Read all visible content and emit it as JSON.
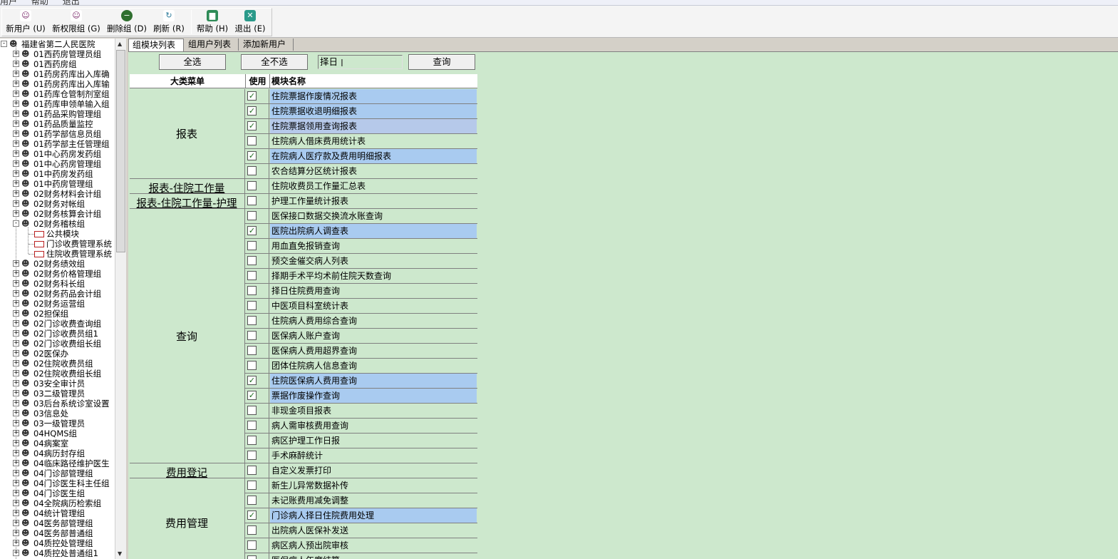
{
  "menubar": {
    "items": [
      "用户",
      "帮助",
      "退出"
    ]
  },
  "toolbar": {
    "buttons": [
      {
        "label": "新用户 (U)",
        "icon": "user-add-icon"
      },
      {
        "label": "新权限组 (G)",
        "icon": "group-add-icon"
      },
      {
        "label": "删除组 (D)",
        "icon": "delete-icon"
      },
      {
        "label": "刷新 (R)",
        "icon": "refresh-icon"
      },
      {
        "label": "帮助 (H)",
        "icon": "help-book-icon"
      },
      {
        "label": "退出 (E)",
        "icon": "exit-icon"
      }
    ]
  },
  "tree": {
    "root": "福建省第二人民医院",
    "groups": [
      "01西药房管理员组",
      "01西药房组",
      "01药房药库出入库确",
      "01药房药库出入库输",
      "01药库仓管制剂室组",
      "01药库申领单输入组",
      "01药品采购管理组",
      "01药品质量监控",
      "01药学部信息员组",
      "01药学部主任管理组",
      "01中心药房发药组",
      "01中心药房管理组",
      "01中药房发药组",
      "01中药房管理组",
      "02财务材料会计组",
      "02财务对帐组",
      "02财务核算会计组",
      "02财务稽核组"
    ],
    "expanded_children": [
      "公共模块",
      "门诊收费管理系统",
      "住院收费管理系统"
    ],
    "groups_after": [
      "02财务绩效组",
      "02财务价格管理组",
      "02财务科长组",
      "02财务药品会计组",
      "02财务运营组",
      "02担保组",
      "02门诊收费查询组",
      "02门诊收费员组1",
      "02门诊收费组长组",
      "02医保办",
      "02住院收费员组",
      "02住院收费组长组",
      "03安全审计员",
      "03二级管理员",
      "03后台系统诊室设置",
      "03信息处",
      "03一级管理员",
      "04HQMS组",
      "04病案室",
      "04病历封存组",
      "04临床路径维护医生",
      "04门诊部管理组",
      "04门诊医生科主任组",
      "04门诊医生组",
      "04全院病历检索组",
      "04统计管理组",
      "04医务部管理组",
      "04医务部普通组",
      "04质控处管理组",
      "04质控处普通组1"
    ]
  },
  "tabs": [
    "组模块列表",
    "组用户列表",
    "添加新用户"
  ],
  "controls": {
    "select_all": "全选",
    "select_none": "全不选",
    "filter_value": "择日",
    "query": "查询"
  },
  "grid": {
    "headers": {
      "category": "大类菜单",
      "use": "使用",
      "module": "模块名称"
    },
    "categories": [
      {
        "name": "报表",
        "span": 6
      },
      {
        "name": "报表-住院工作量",
        "span": 1
      },
      {
        "name": "报表-住院工作量-护理",
        "span": 1
      },
      {
        "name": "查询",
        "span": 17
      },
      {
        "name": "费用登记",
        "span": 1
      },
      {
        "name": "费用管理",
        "span": 6
      }
    ],
    "rows": [
      {
        "name": "住院票据作废情况报表",
        "checked": true
      },
      {
        "name": "住院票据收退明细报表",
        "checked": true
      },
      {
        "name": "住院票据领用查询报表",
        "checked": true
      },
      {
        "name": "住院病人借床费用统计表",
        "checked": false
      },
      {
        "name": "在院病人医疗款及费用明细报表",
        "checked": true
      },
      {
        "name": "农合结算分区统计报表",
        "checked": false
      },
      {
        "name": "住院收费员工作量汇总表",
        "checked": false
      },
      {
        "name": "护理工作量统计报表",
        "checked": false
      },
      {
        "name": "医保接口数据交换流水账查询",
        "checked": false
      },
      {
        "name": "医院出院病人调查表",
        "checked": true
      },
      {
        "name": "用血直免报销查询",
        "checked": false
      },
      {
        "name": "预交金催交病人列表",
        "checked": false
      },
      {
        "name": "择期手术平均术前住院天数查询",
        "checked": false
      },
      {
        "name": "择日住院费用查询",
        "checked": false
      },
      {
        "name": "中医项目科室统计表",
        "checked": false
      },
      {
        "name": "住院病人费用综合查询",
        "checked": false
      },
      {
        "name": "医保病人账户查询",
        "checked": false
      },
      {
        "name": "医保病人费用超界查询",
        "checked": false
      },
      {
        "name": "团体住院病人信息查询",
        "checked": false
      },
      {
        "name": "住院医保病人费用查询",
        "checked": true
      },
      {
        "name": "票据作废操作查询",
        "checked": true
      },
      {
        "name": "非现金项目报表",
        "checked": false
      },
      {
        "name": "病人需审核费用查询",
        "checked": false
      },
      {
        "name": "病区护理工作日报",
        "checked": false
      },
      {
        "name": "手术麻醉统计",
        "checked": false
      },
      {
        "name": "自定义发票打印",
        "checked": false
      },
      {
        "name": "新生儿异常数据补传",
        "checked": false
      },
      {
        "name": "未记账费用减免调整",
        "checked": false
      },
      {
        "name": "门诊病人择日住院费用处理",
        "checked": true
      },
      {
        "name": "出院病人医保补发送",
        "checked": false
      },
      {
        "name": "病区病人预出院审核",
        "checked": false
      },
      {
        "name": "医保病人年度结算",
        "checked": false
      }
    ]
  },
  "colors": {
    "panel_bg": "#cde8cd",
    "selected_row": "#a9cbf0",
    "toolbar_bg": "#f4f4f4"
  }
}
